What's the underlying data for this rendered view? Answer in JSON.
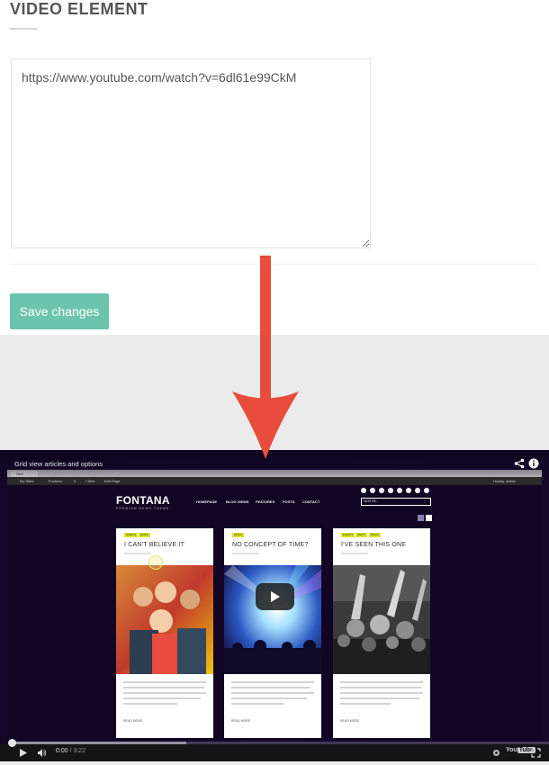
{
  "form": {
    "section_title": "VIDEO ELEMENT",
    "video_url": "https://www.youtube.com/watch?v=6dl61e99CkM",
    "save_label": "Save changes",
    "save_color": "#6cc4ae"
  },
  "arrow": {
    "color": "#e74c3c",
    "icon": "arrow-down-icon"
  },
  "video": {
    "title": "Grid view articles and options",
    "current_time": "0:00",
    "duration": "/ 3:22",
    "logo_you": "You",
    "logo_tube": "Tube",
    "recorded_page": {
      "tab_label": "Grid",
      "admin_items": [
        "My Sites",
        "Fontana",
        "0",
        "+ New",
        "Edit Page"
      ],
      "howdy": "Howdy, admin",
      "site_logo": "FONTANA",
      "site_tagline": "PREMIUM NEWS THEME",
      "nav_items": [
        "HOMEPAGE",
        "BLOG VIEWS",
        "FEATURES",
        "POSTS",
        "CONTACT"
      ],
      "search_text": "NEW RE...",
      "articles": [
        {
          "tags": [
            "EVENTS",
            "MUSIC"
          ],
          "title": "I CAN'T BELIEVE IT",
          "readmore": "READ MORE"
        },
        {
          "tags": [
            "MUSIC"
          ],
          "title": "NO CONCEPT OF TIME?",
          "readmore": "READ MORE"
        },
        {
          "tags": [
            "EVENTS",
            "PARTY",
            "MUSIC"
          ],
          "title": "I'VE SEEN THIS ONE",
          "readmore": "READ MORE"
        }
      ]
    }
  }
}
